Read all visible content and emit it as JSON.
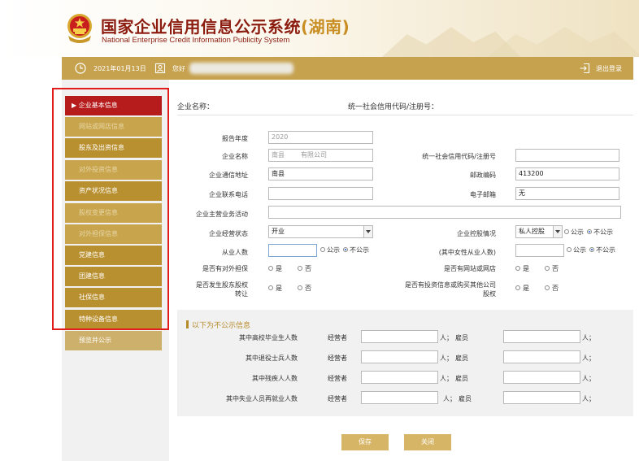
{
  "header": {
    "title": "国家企业信用信息公示系统",
    "province": "(湖南)",
    "subtitle": "National Enterprise Credit Information Publicity System"
  },
  "toolbar": {
    "date": "2021年01月13日",
    "greeting": "您好",
    "logout": "退出登录"
  },
  "sidebar": {
    "items": [
      {
        "label": "企业基本信息",
        "state": "active"
      },
      {
        "label": "网站或网店信息",
        "state": "dim"
      },
      {
        "label": "股东及出资信息",
        "state": "norm"
      },
      {
        "label": "对外投资信息",
        "state": "dim"
      },
      {
        "label": "资产状况信息",
        "state": "norm"
      },
      {
        "label": "股权变更信息",
        "state": "dim"
      },
      {
        "label": "对外担保信息",
        "state": "dim"
      },
      {
        "label": "党建信息",
        "state": "norm"
      },
      {
        "label": "团建信息",
        "state": "norm"
      },
      {
        "label": "社保信息",
        "state": "norm"
      },
      {
        "label": "特种设备信息",
        "state": "norm"
      },
      {
        "label": "预览并公示",
        "state": "last"
      }
    ]
  },
  "summary": {
    "company_name_label": "企业名称：",
    "credit_code_label": "统一社会信用代码/注册号："
  },
  "form": {
    "report_year": {
      "label": "报告年度",
      "value": "2020"
    },
    "company_name": {
      "label": "企业名称",
      "value_prefix": "南县",
      "value_suffix": "有限公司"
    },
    "credit_code": {
      "label": "统一社会信用代码/注册号",
      "value": ""
    },
    "address": {
      "label": "企业通信地址",
      "value": "南县"
    },
    "postcode": {
      "label": "邮政编码",
      "value": "413200"
    },
    "phone": {
      "label": "企业联系电话",
      "value": ""
    },
    "email": {
      "label": "电子邮箱",
      "value": "无"
    },
    "business_activity": {
      "label": "企业主营业务活动",
      "value": ""
    },
    "operating_status": {
      "label": "企业经营状态",
      "value": "开业"
    },
    "holding": {
      "label": "企业控股情况",
      "value": "私人控股",
      "public": "公示",
      "private": "不公示"
    },
    "employees": {
      "label": "从业人数",
      "value": "",
      "public": "公示",
      "private": "不公示"
    },
    "female_employees": {
      "label": "(其中女性从业人数)",
      "value": "",
      "public": "公示",
      "private": "不公示"
    },
    "guarantee": {
      "label": "是否有对外担保",
      "yes": "是",
      "no": "否"
    },
    "website": {
      "label": "是否有网站或网店",
      "yes": "是",
      "no": "否"
    },
    "equity_transfer": {
      "label_line1": "是否发生股东股权",
      "label_line2": "转让",
      "yes": "是",
      "no": "否"
    },
    "investment": {
      "label_line1": "是否有投资信息或购买其他公司",
      "label_line2": "股权",
      "yes": "是",
      "no": "否"
    }
  },
  "private_section": {
    "title": "以下为不公示信息",
    "operator_label": "经营者",
    "employee_label": "雇员",
    "person_unit": "人；",
    "rows": [
      {
        "label": "其中高校毕业生人数"
      },
      {
        "label": "其中退役士兵人数"
      },
      {
        "label": "其中残疾人人数"
      },
      {
        "label": "其中失业人员再就业人数"
      }
    ]
  },
  "actions": {
    "save": "保存",
    "close": "关闭"
  },
  "colors": {
    "gold": "#c6a24f",
    "active_red": "#b71c1c",
    "title_red": "#8c1c10",
    "annotation_red": "#e21b1b"
  }
}
